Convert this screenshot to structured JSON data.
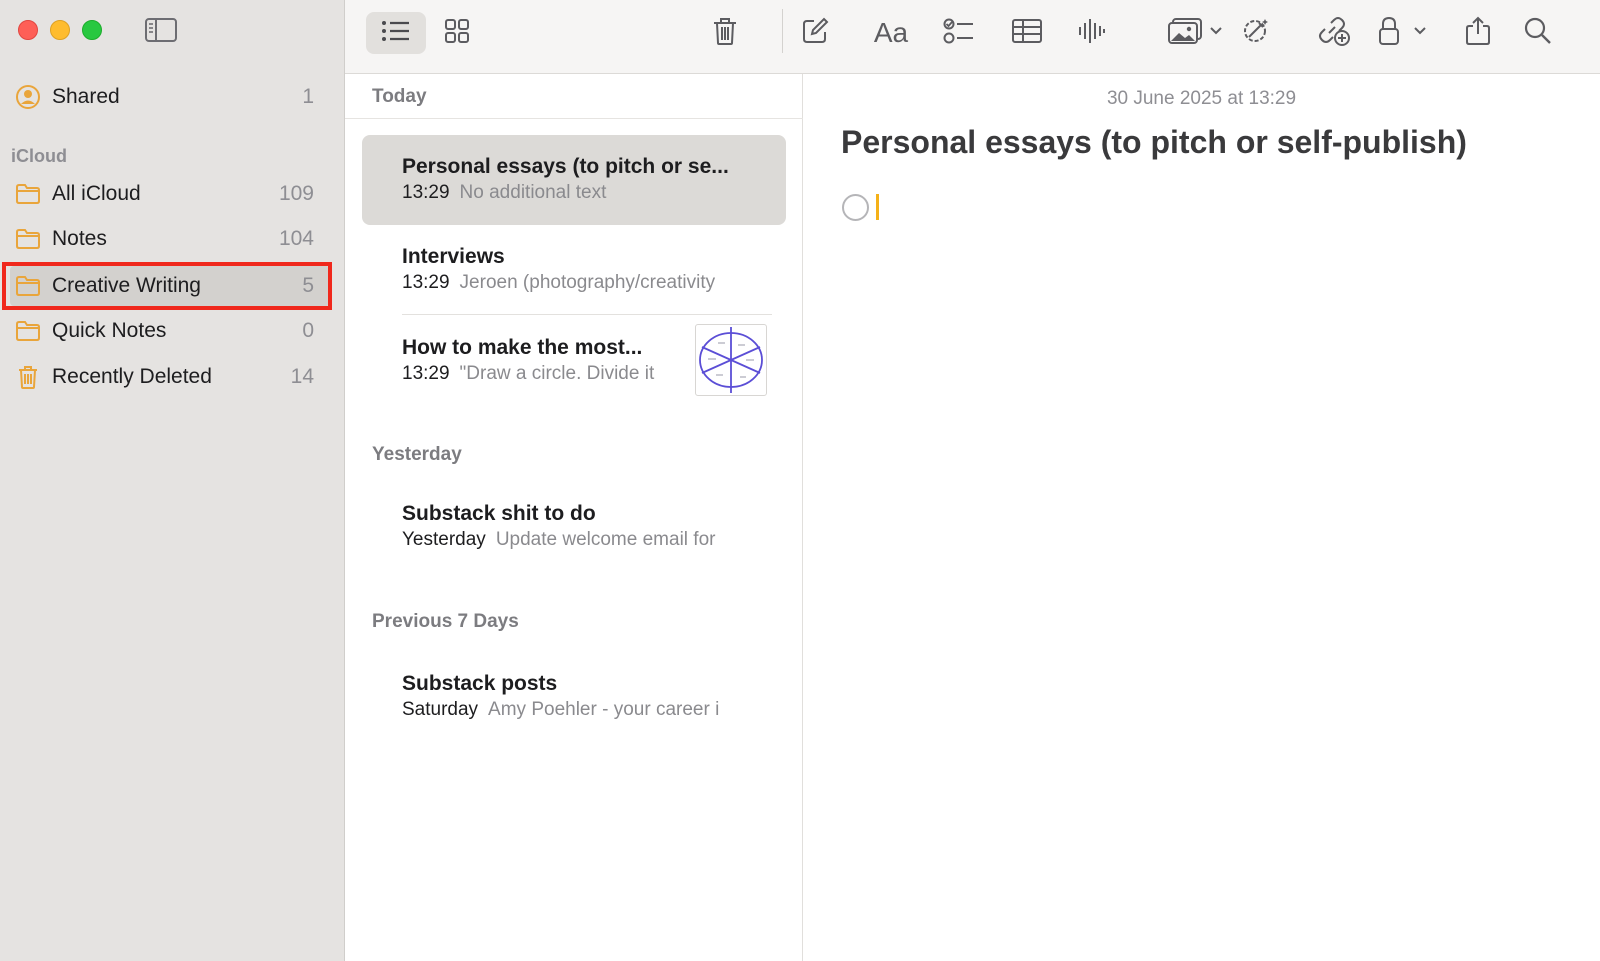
{
  "sidebar": {
    "shared": {
      "label": "Shared",
      "count": "1"
    },
    "section_label": "iCloud",
    "folders": [
      {
        "label": "All iCloud",
        "count": "109"
      },
      {
        "label": "Notes",
        "count": "104"
      },
      {
        "label": "Creative Writing",
        "count": "5"
      },
      {
        "label": "Quick Notes",
        "count": "0"
      },
      {
        "label": "Recently Deleted",
        "count": "14"
      }
    ]
  },
  "toolbar": {
    "format_label": "Aa",
    "icons": [
      "list-view-icon",
      "gallery-view-icon",
      "trash-icon",
      "compose-icon",
      "format-icon",
      "checklist-icon",
      "table-icon",
      "audio-icon",
      "media-icon",
      "writing-tools-icon",
      "collaborate-icon",
      "lock-icon",
      "share-icon",
      "search-icon"
    ]
  },
  "notes_list": {
    "groups": [
      {
        "header": "Today"
      },
      {
        "header": "Yesterday"
      },
      {
        "header": "Previous 7 Days"
      }
    ],
    "notes": [
      {
        "title": "Personal essays (to pitch or se...",
        "time": "13:29",
        "snippet": "No additional text"
      },
      {
        "title": "Interviews",
        "time": "13:29",
        "snippet": "Jeroen (photography/creativity"
      },
      {
        "title": "How to make the most...",
        "time": "13:29",
        "snippet": "\"Draw a circle. Divide it"
      },
      {
        "title": "Substack shit to do",
        "time": "Yesterday",
        "snippet": "Update welcome email for"
      },
      {
        "title": "Substack posts",
        "time": "Saturday",
        "snippet": "Amy Poehler - your career i"
      }
    ]
  },
  "editor": {
    "date": "30 June 2025 at 13:29",
    "title": "Personal essays (to pitch or self-publish)"
  },
  "colors": {
    "accent": "#e9a53b",
    "highlight": "#f0281c",
    "caret": "#f5b118"
  }
}
